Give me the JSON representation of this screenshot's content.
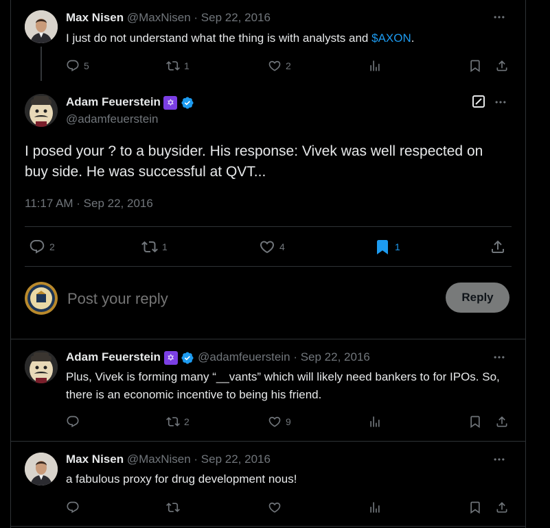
{
  "tweet1": {
    "name": "Max Nisen",
    "handle": "@MaxNisen",
    "date": "· Sep 22, 2016",
    "text_pre": "I just do not understand what the thing is with analysts and ",
    "text_link": "$AXON",
    "text_post": ".",
    "replies": "5",
    "reposts": "1",
    "likes": "2"
  },
  "main": {
    "name": "Adam Feuerstein",
    "handle": "@adamfeuerstein",
    "badge": "✡",
    "text": "I posed your ? to a buysider. His response: Vivek was well respected on buy side. He was successful at QVT...",
    "timestamp": "11:17 AM · Sep 22, 2016",
    "replies": "2",
    "reposts": "1",
    "likes": "4",
    "bookmarks": "1"
  },
  "composer": {
    "placeholder": "Post your reply",
    "reply_label": "Reply"
  },
  "reply1": {
    "name": "Adam Feuerstein",
    "handle": "@adamfeuerstein",
    "badge": "✡",
    "date": "· Sep 22, 2016",
    "text": "Plus, Vivek is forming many “__vants” which will likely need bankers to for IPOs. So, there is an economic incentive to being his friend.",
    "reposts": "2",
    "likes": "9"
  },
  "reply2": {
    "name": "Max Nisen",
    "handle": "@MaxNisen",
    "date": "· Sep 22, 2016",
    "text": "a fabulous proxy for drug development nous!"
  },
  "colors": {
    "accent": "#1d9bf0",
    "muted": "#71767b",
    "badge": "#7b3fe4"
  }
}
